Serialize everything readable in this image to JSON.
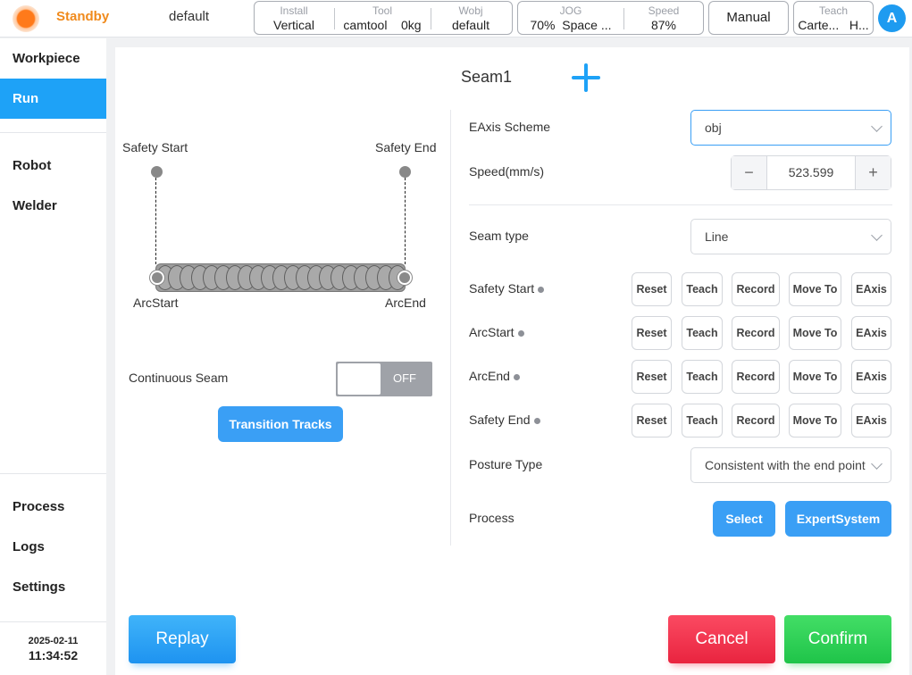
{
  "topbar": {
    "status": "Standby",
    "workspace": "default",
    "install": {
      "label": "Install",
      "value": "Vertical"
    },
    "tool": {
      "label": "Tool",
      "name": "camtool",
      "weight": "0kg"
    },
    "wobj": {
      "label": "Wobj",
      "value": "default"
    },
    "jog": {
      "label": "JOG",
      "percent": "70%",
      "mode": "Space ..."
    },
    "speed": {
      "label": "Speed",
      "value": "87%"
    },
    "mode_button": "Manual",
    "teach": {
      "label": "Teach",
      "frame": "Carte...",
      "extra": "H..."
    },
    "avatar": "A"
  },
  "sidebar": {
    "items": [
      {
        "label": "Workpiece",
        "active": false
      },
      {
        "label": "Run",
        "active": true
      },
      {
        "label": "Robot",
        "active": false
      },
      {
        "label": "Welder",
        "active": false
      },
      {
        "label": "Process",
        "active": false
      },
      {
        "label": "Logs",
        "active": false
      },
      {
        "label": "Settings",
        "active": false
      }
    ],
    "date": "2025-02-11",
    "time": "11:34:52"
  },
  "seam": {
    "title": "Seam1",
    "diagram": {
      "safety_start": "Safety Start",
      "safety_end": "Safety End",
      "arc_start": "ArcStart",
      "arc_end": "ArcEnd"
    },
    "continuous_seam_label": "Continuous Seam",
    "continuous_seam_state": "OFF",
    "transition_button": "Transition Tracks"
  },
  "form": {
    "eaxis_scheme_label": "EAxis Scheme",
    "eaxis_scheme_value": "obj",
    "speed_label": "Speed(mm/s)",
    "speed_value": "523.599",
    "seam_type_label": "Seam type",
    "seam_type_value": "Line",
    "points": [
      {
        "label": "Safety Start"
      },
      {
        "label": "ArcStart"
      },
      {
        "label": "ArcEnd"
      },
      {
        "label": "Safety End"
      }
    ],
    "point_buttons": [
      "Reset",
      "Teach",
      "Record",
      "Move To",
      "EAxis"
    ],
    "posture_label": "Posture Type",
    "posture_value": "Consistent with the end point",
    "process_label": "Process",
    "select_button": "Select",
    "expert_button": "ExpertSystem"
  },
  "footer": {
    "replay": "Replay",
    "cancel": "Cancel",
    "confirm": "Confirm"
  },
  "colors": {
    "accent": "#1ea2f7",
    "standby": "#f08a1c",
    "cancel": "#e9243f",
    "confirm": "#1fc449"
  }
}
